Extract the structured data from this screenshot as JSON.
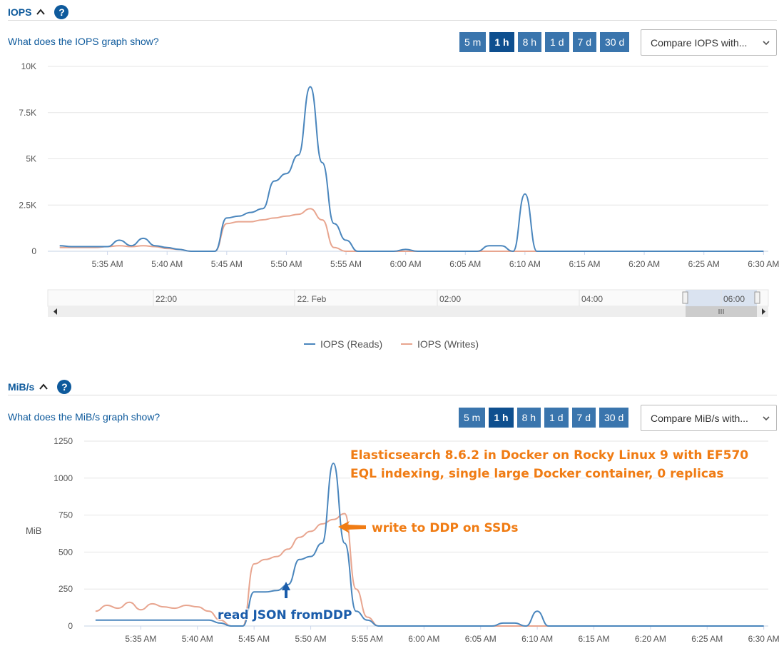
{
  "iops_section": {
    "title": "IOPS",
    "help_label": "?",
    "what_link": "What does the IOPS graph show?",
    "ranges": [
      "5 m",
      "1 h",
      "8 h",
      "1 d",
      "7 d",
      "30 d"
    ],
    "active_range": "1 h",
    "compare_label": "Compare IOPS with..."
  },
  "mibs_section": {
    "title": "MiB/s",
    "help_label": "?",
    "what_link": "What does the MiB/s graph show?",
    "ranges": [
      "5 m",
      "1 h",
      "8 h",
      "1 d",
      "7 d",
      "30 d"
    ],
    "active_range": "1 h",
    "compare_label": "Compare MiB/s with..."
  },
  "navigator": {
    "labels": [
      "22:00",
      "22. Feb",
      "02:00",
      "04:00",
      "06:00"
    ]
  },
  "colors": {
    "reads": "#4a86bd",
    "writes": "#e8a58f",
    "accent": "#0e5a9c",
    "annotation_orange": "#f07c14",
    "annotation_blue": "#1a5caa"
  },
  "annotations": {
    "title_line1": "Elasticsearch 8.6.2 in Docker on Rocky Linux 9 with EF570",
    "title_line2": "EQL indexing, single large Docker container, 0 replicas",
    "write_note": "write to DDP on SSDs",
    "read_note": "read JSON fromDDP"
  },
  "chart_data": [
    {
      "type": "line",
      "x": [
        "5:31 AM",
        "5:32 AM",
        "5:33 AM",
        "5:34 AM",
        "5:35 AM",
        "5:36 AM",
        "5:37 AM",
        "5:38 AM",
        "5:39 AM",
        "5:40 AM",
        "5:41 AM",
        "5:42 AM",
        "5:43 AM",
        "5:44 AM",
        "5:45 AM",
        "5:46 AM",
        "5:47 AM",
        "5:48 AM",
        "5:49 AM",
        "5:50 AM",
        "5:51 AM",
        "5:52 AM",
        "5:53 AM",
        "5:54 AM",
        "5:55 AM",
        "5:56 AM",
        "5:57 AM",
        "5:58 AM",
        "5:59 AM",
        "6:00 AM",
        "6:01 AM",
        "6:02 AM",
        "6:03 AM",
        "6:04 AM",
        "6:05 AM",
        "6:06 AM",
        "6:07 AM",
        "6:08 AM",
        "6:09 AM",
        "6:10 AM",
        "6:11 AM",
        "6:12 AM",
        "6:13 AM",
        "6:14 AM",
        "6:15 AM",
        "6:16 AM",
        "6:17 AM",
        "6:18 AM",
        "6:19 AM",
        "6:20 AM",
        "6:21 AM",
        "6:22 AM",
        "6:23 AM",
        "6:24 AM",
        "6:25 AM",
        "6:26 AM",
        "6:27 AM",
        "6:28 AM",
        "6:29 AM",
        "6:30 AM"
      ],
      "x_ticks": [
        "5:35 AM",
        "5:40 AM",
        "5:45 AM",
        "5:50 AM",
        "5:55 AM",
        "6:00 AM",
        "6:05 AM",
        "6:10 AM",
        "6:15 AM",
        "6:20 AM",
        "6:25 AM",
        "6:30 AM"
      ],
      "y_ticks": [
        "0",
        "2.5K",
        "5K",
        "7.5K",
        "10K"
      ],
      "ylim": [
        0,
        10000
      ],
      "series": [
        {
          "name": "IOPS (Reads)",
          "values": [
            300,
            250,
            250,
            250,
            250,
            600,
            300,
            700,
            300,
            200,
            100,
            0,
            0,
            0,
            1800,
            1900,
            2100,
            2300,
            3800,
            4200,
            5200,
            8900,
            4800,
            1500,
            600,
            0,
            0,
            0,
            0,
            100,
            0,
            0,
            0,
            0,
            0,
            0,
            300,
            300,
            0,
            3100,
            0,
            0,
            0,
            0,
            0,
            0,
            0,
            0,
            0,
            0,
            0,
            0,
            0,
            0,
            0,
            0,
            0,
            0,
            0,
            0
          ]
        },
        {
          "name": "IOPS (Writes)",
          "values": [
            200,
            200,
            200,
            200,
            250,
            300,
            250,
            300,
            250,
            150,
            100,
            0,
            0,
            0,
            1500,
            1600,
            1600,
            1700,
            1800,
            1900,
            2000,
            2300,
            1700,
            200,
            0,
            0,
            0,
            0,
            0,
            0,
            0,
            0,
            0,
            0,
            0,
            0,
            0,
            0,
            0,
            0,
            0,
            0,
            0,
            0,
            0,
            0,
            0,
            0,
            0,
            0,
            0,
            0,
            0,
            0,
            0,
            0,
            0,
            0,
            0,
            0
          ]
        }
      ],
      "legend": "bottom-center",
      "grid": true
    },
    {
      "type": "line",
      "x": [
        "5:31 AM",
        "5:32 AM",
        "5:33 AM",
        "5:34 AM",
        "5:35 AM",
        "5:36 AM",
        "5:37 AM",
        "5:38 AM",
        "5:39 AM",
        "5:40 AM",
        "5:41 AM",
        "5:42 AM",
        "5:43 AM",
        "5:44 AM",
        "5:45 AM",
        "5:46 AM",
        "5:47 AM",
        "5:48 AM",
        "5:49 AM",
        "5:50 AM",
        "5:51 AM",
        "5:52 AM",
        "5:53 AM",
        "5:54 AM",
        "5:55 AM",
        "5:56 AM",
        "5:57 AM",
        "5:58 AM",
        "5:59 AM",
        "6:00 AM",
        "6:01 AM",
        "6:02 AM",
        "6:03 AM",
        "6:04 AM",
        "6:05 AM",
        "6:06 AM",
        "6:07 AM",
        "6:08 AM",
        "6:09 AM",
        "6:10 AM",
        "6:11 AM",
        "6:12 AM",
        "6:13 AM",
        "6:14 AM",
        "6:15 AM",
        "6:16 AM",
        "6:17 AM",
        "6:18 AM",
        "6:19 AM",
        "6:20 AM",
        "6:21 AM",
        "6:22 AM",
        "6:23 AM",
        "6:24 AM",
        "6:25 AM",
        "6:26 AM",
        "6:27 AM",
        "6:28 AM",
        "6:29 AM",
        "6:30 AM"
      ],
      "x_ticks": [
        "5:35 AM",
        "5:40 AM",
        "5:45 AM",
        "5:50 AM",
        "5:55 AM",
        "6:00 AM",
        "6:05 AM",
        "6:10 AM",
        "6:15 AM",
        "6:20 AM",
        "6:25 AM",
        "6:30 AM"
      ],
      "y_ticks": [
        "0",
        "250",
        "500",
        "750",
        "1000",
        "1250"
      ],
      "ylabel": "MiB",
      "ylim": [
        0,
        1250
      ],
      "series": [
        {
          "name": "IOPS (Reads)",
          "values": [
            40,
            40,
            40,
            40,
            40,
            40,
            40,
            40,
            40,
            40,
            40,
            20,
            0,
            0,
            230,
            230,
            240,
            280,
            450,
            470,
            560,
            1100,
            560,
            100,
            40,
            0,
            0,
            0,
            0,
            0,
            0,
            0,
            0,
            0,
            0,
            0,
            20,
            20,
            0,
            100,
            0,
            0,
            0,
            0,
            0,
            0,
            0,
            0,
            0,
            0,
            0,
            0,
            0,
            0,
            0,
            0,
            0,
            0,
            0,
            0
          ]
        },
        {
          "name": "IOPS (Writes)",
          "values": [
            100,
            140,
            120,
            160,
            110,
            150,
            130,
            120,
            140,
            130,
            100,
            40,
            0,
            0,
            420,
            450,
            470,
            520,
            600,
            640,
            690,
            720,
            760,
            250,
            60,
            0,
            0,
            0,
            0,
            0,
            0,
            0,
            0,
            0,
            0,
            0,
            0,
            0,
            0,
            0,
            0,
            0,
            0,
            0,
            0,
            0,
            0,
            0,
            0,
            0,
            0,
            0,
            0,
            0,
            0,
            0,
            0,
            0,
            0,
            0
          ]
        }
      ],
      "grid": true
    }
  ]
}
